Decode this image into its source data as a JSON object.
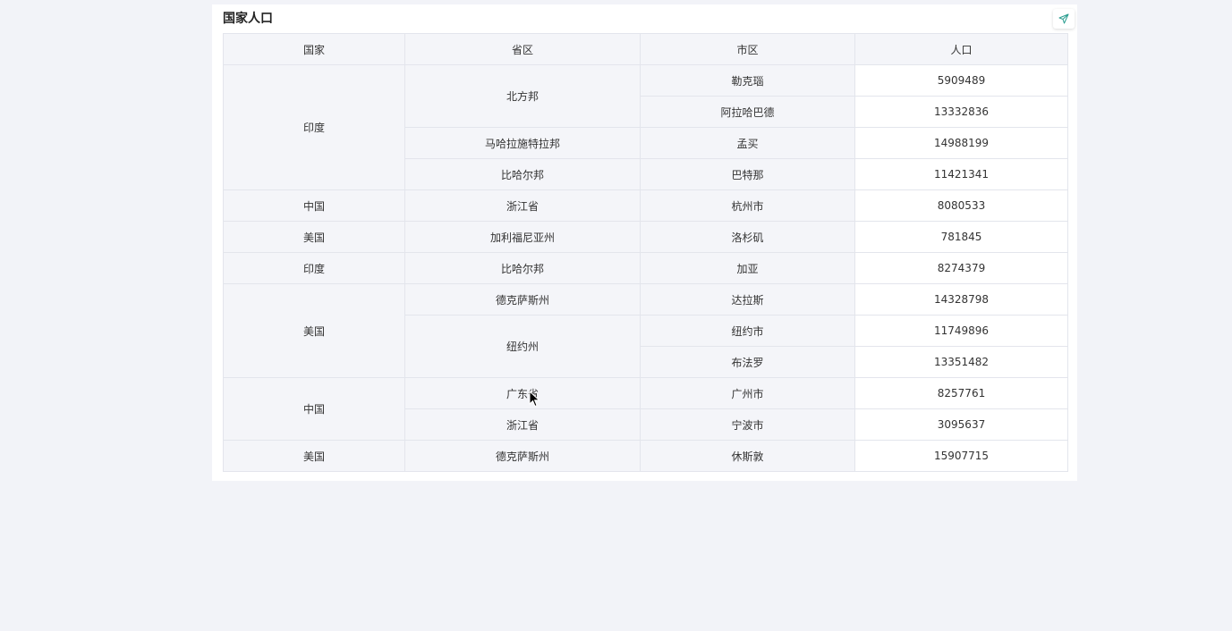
{
  "card": {
    "title": "国家人口",
    "send_icon": "send-icon"
  },
  "table": {
    "headers": [
      "国家",
      "省区",
      "市区",
      "人口"
    ],
    "countries": [
      "印度",
      "中国",
      "美国",
      "印度",
      "美国",
      "中国",
      "美国"
    ],
    "provinces": [
      "北方邦",
      "马哈拉施特拉邦",
      "比哈尔邦",
      "浙江省",
      "加利福尼亚州",
      "比哈尔邦",
      "德克萨斯州",
      "纽约州",
      "广东省",
      "浙江省",
      "德克萨斯州"
    ],
    "cities": [
      "勒克瑙",
      "阿拉哈巴德",
      "孟买",
      "巴特那",
      "杭州市",
      "洛杉矶",
      "加亚",
      "达拉斯",
      "纽约市",
      "布法罗",
      "广州市",
      "宁波市",
      "休斯敦"
    ],
    "populations": [
      "5909489",
      "13332836",
      "14988199",
      "11421341",
      "8080533",
      "781845",
      "8274379",
      "14328798",
      "11749896",
      "13351482",
      "8257761",
      "3095637",
      "15907715"
    ]
  },
  "colors": {
    "background": "#f2f3f8",
    "card": "#ffffff",
    "header_bg": "#f4f5f9",
    "border": "#e3e5ec",
    "icon_accent": "#2a9d8f"
  }
}
